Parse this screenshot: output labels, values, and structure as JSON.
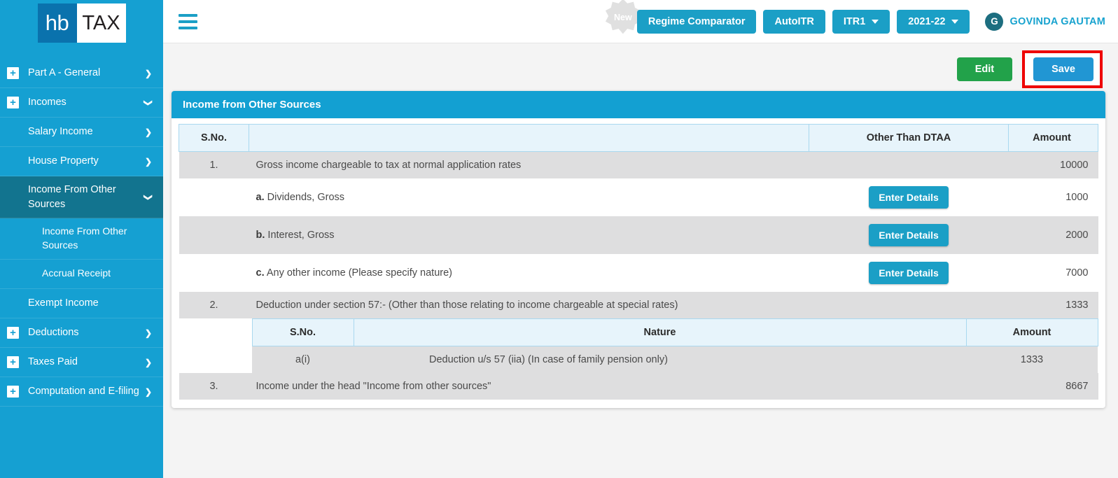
{
  "brand": {
    "logo_primary": "hb",
    "logo_secondary": "TAX",
    "logo_bg": "#0a72ad",
    "sidebar_bg": "#15a0d2"
  },
  "sidebar": {
    "items": [
      {
        "label": "Part A - General",
        "level": 1,
        "icon": "plus-box-icon",
        "chevron": "chevron-right-icon",
        "active": false
      },
      {
        "label": "Incomes",
        "level": 1,
        "icon": "plus-box-icon",
        "chevron": "chevron-down-icon",
        "active": false
      },
      {
        "label": "Salary Income",
        "level": 2,
        "icon": "",
        "chevron": "chevron-right-icon",
        "active": false
      },
      {
        "label": "House Property",
        "level": 2,
        "icon": "",
        "chevron": "chevron-right-icon",
        "active": false
      },
      {
        "label": "Income From Other Sources",
        "level": 2,
        "icon": "",
        "chevron": "chevron-down-icon",
        "active": true
      },
      {
        "label": "Income From Other Sources",
        "level": 3,
        "icon": "",
        "chevron": "",
        "active": false
      },
      {
        "label": "Accrual Receipt",
        "level": 3,
        "icon": "",
        "chevron": "",
        "active": false
      },
      {
        "label": "Exempt Income",
        "level": 2,
        "icon": "",
        "chevron": "",
        "active": false
      },
      {
        "label": "Deductions",
        "level": 1,
        "icon": "plus-box-icon",
        "chevron": "chevron-right-icon",
        "active": false
      },
      {
        "label": "Taxes Paid",
        "level": 1,
        "icon": "plus-box-icon",
        "chevron": "chevron-right-icon",
        "active": false
      },
      {
        "label": "Computation and E-filing",
        "level": 1,
        "icon": "plus-box-icon",
        "chevron": "chevron-right-icon",
        "active": false
      }
    ]
  },
  "topbar": {
    "menu_icon": "hamburger-icon",
    "new_badge": "New",
    "regime_comparator": "Regime Comparator",
    "auto_itr": "AutoITR",
    "itr_form": "ITR1",
    "assessment_year": "2021-22",
    "user_initial": "G",
    "user_name": "GOVINDA GAUTAM",
    "accent_color": "#1b9fc6",
    "user_name_color": "#18a3cf"
  },
  "actions": {
    "edit_label": "Edit",
    "save_label": "Save",
    "edit_color": "#22a24a",
    "save_color": "#2196d3",
    "save_highlight_color": "#ee0000"
  },
  "card": {
    "title": "Income from Other Sources",
    "header_bg": "#13a0d2",
    "columns": {
      "sno": "S.No.",
      "description": "",
      "dtaa": "Other Than DTAA",
      "amount": "Amount"
    },
    "rows": [
      {
        "sno": "1.",
        "prefix": "",
        "desc": "Gross income chargeable to tax at normal application rates",
        "button": "",
        "amount": "10000",
        "striped": true
      },
      {
        "sno": "",
        "prefix": "a.",
        "desc": "Dividends, Gross",
        "button": "Enter Details",
        "amount": "1000",
        "striped": false
      },
      {
        "sno": "",
        "prefix": "b.",
        "desc": "Interest, Gross",
        "button": "Enter Details",
        "amount": "2000",
        "striped": true
      },
      {
        "sno": "",
        "prefix": "c.",
        "desc": "Any other income (Please specify nature)",
        "button": "Enter Details",
        "amount": "7000",
        "striped": false
      },
      {
        "sno": "2.",
        "prefix": "",
        "desc": "Deduction under section 57:- (Other than those relating to income chargeable at special rates)",
        "button": "",
        "amount": "1333",
        "striped": true
      }
    ],
    "subtable": {
      "columns": {
        "sno": "S.No.",
        "nature": "Nature",
        "amount": "Amount"
      },
      "rows": [
        {
          "sno": "a(i)",
          "nature": "Deduction u/s 57 (iia) (In case of family pension only)",
          "amount": "1333"
        }
      ]
    },
    "final_row": {
      "sno": "3.",
      "desc": "Income under the head \"Income from other sources\"",
      "amount": "8667",
      "striped": true
    },
    "details_button_label": "Enter Details"
  }
}
